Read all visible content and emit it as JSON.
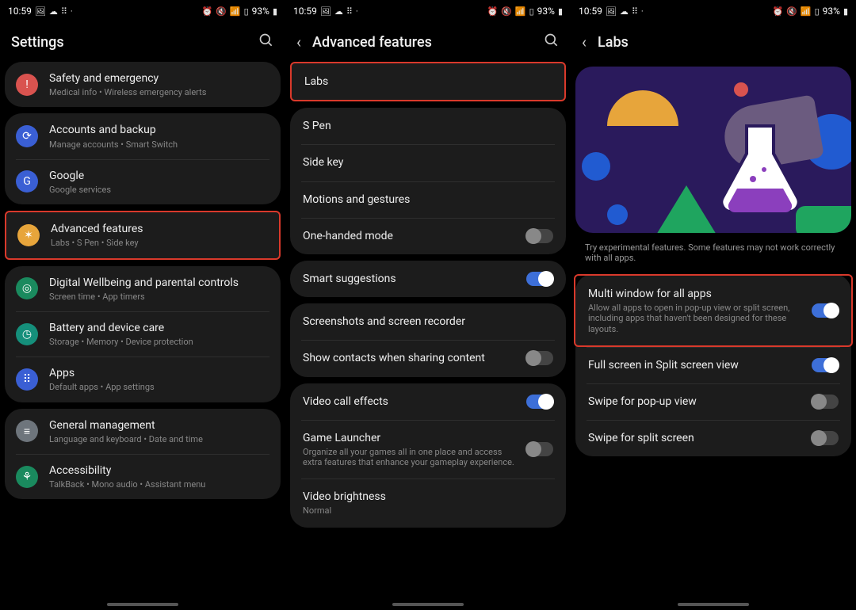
{
  "status": {
    "time": "10:59",
    "battery": "93%"
  },
  "screen1": {
    "title": "Settings",
    "groups": [
      {
        "rows": [
          {
            "id": "safety",
            "name": "safety-and-emergency",
            "color": "#d9534f",
            "icon": "!",
            "label": "Safety and emergency",
            "sub": "Medical info  •  Wireless emergency alerts"
          }
        ]
      },
      {
        "rows": [
          {
            "id": "accounts",
            "name": "accounts-and-backup",
            "color": "#3a5fd4",
            "icon": "⟳",
            "label": "Accounts and backup",
            "sub": "Manage accounts  •  Smart Switch"
          },
          {
            "id": "google",
            "name": "google",
            "color": "#3a5fd4",
            "icon": "G",
            "label": "Google",
            "sub": "Google services"
          }
        ]
      },
      {
        "highlight": true,
        "rows": [
          {
            "id": "advfeat",
            "name": "advanced-features",
            "color": "#e7a53b",
            "icon": "✶",
            "label": "Advanced features",
            "sub": "Labs  •  S Pen  •  Side key"
          }
        ]
      },
      {
        "rows": [
          {
            "id": "digwell",
            "name": "digital-wellbeing",
            "color": "#1a8a5e",
            "icon": "◎",
            "label": "Digital Wellbeing and parental controls",
            "sub": "Screen time  •  App timers"
          },
          {
            "id": "battery",
            "name": "battery-device-care",
            "color": "#158f7b",
            "icon": "◷",
            "label": "Battery and device care",
            "sub": "Storage  •  Memory  •  Device protection"
          },
          {
            "id": "apps",
            "name": "apps",
            "color": "#3a5fd4",
            "icon": "⠿",
            "label": "Apps",
            "sub": "Default apps  •  App settings"
          }
        ]
      },
      {
        "rows": [
          {
            "id": "general",
            "name": "general-management",
            "color": "#6e757c",
            "icon": "≡",
            "label": "General management",
            "sub": "Language and keyboard  •  Date and time"
          },
          {
            "id": "a11y",
            "name": "accessibility",
            "color": "#1a8a5e",
            "icon": "⚘",
            "label": "Accessibility",
            "sub": "TalkBack  •  Mono audio  •  Assistant menu"
          }
        ]
      }
    ]
  },
  "screen2": {
    "title": "Advanced features",
    "groups": [
      {
        "highlight": true,
        "rows": [
          {
            "label": "Labs"
          }
        ]
      },
      {
        "rows": [
          {
            "label": "S Pen"
          },
          {
            "label": "Side key"
          },
          {
            "label": "Motions and gestures"
          },
          {
            "label": "One-handed mode",
            "toggle": false
          }
        ]
      },
      {
        "rows": [
          {
            "label": "Smart suggestions",
            "toggle": true
          }
        ]
      },
      {
        "rows": [
          {
            "label": "Screenshots and screen recorder"
          },
          {
            "label": "Show contacts when sharing content",
            "toggle": false
          }
        ]
      },
      {
        "rows": [
          {
            "label": "Video call effects",
            "toggle": true
          },
          {
            "label": "Game Launcher",
            "toggle": false,
            "sub": "Organize all your games all in one place and access extra features that enhance your gameplay experience."
          },
          {
            "label": "Video brightness",
            "sub": "Normal"
          }
        ]
      }
    ]
  },
  "screen3": {
    "title": "Labs",
    "note": "Try experimental features. Some features may not work correctly with all apps.",
    "groups": [
      {
        "rows": [
          {
            "highlightRow": true,
            "label": "Multi window for all apps",
            "toggle": true,
            "sub": "Allow all apps to open in pop-up view or split screen, including apps that haven't been designed for these layouts."
          },
          {
            "label": "Full screen in Split screen view",
            "toggle": true
          },
          {
            "label": "Swipe for pop-up view",
            "toggle": false
          },
          {
            "label": "Swipe for split screen",
            "toggle": false
          }
        ]
      }
    ]
  }
}
